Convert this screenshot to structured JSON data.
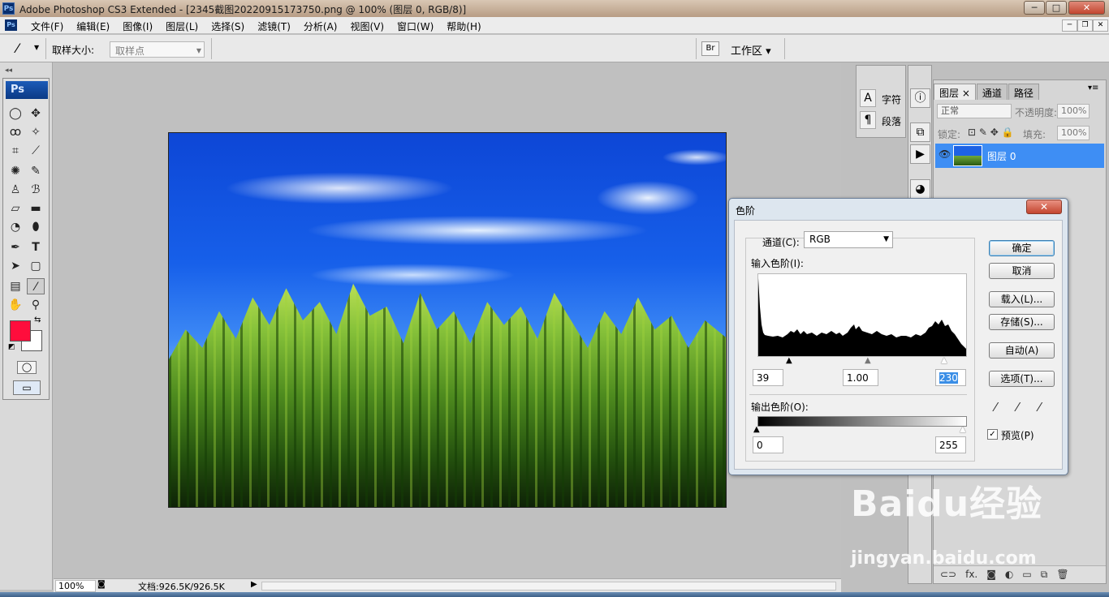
{
  "window": {
    "title": "Adobe Photoshop CS3 Extended - [2345截图20220915173750.png @ 100% (图层 0, RGB/8)]",
    "app_logo": "Ps"
  },
  "menu": [
    "文件(F)",
    "编辑(E)",
    "图像(I)",
    "图层(L)",
    "选择(S)",
    "滤镜(T)",
    "分析(A)",
    "视图(V)",
    "窗口(W)",
    "帮助(H)"
  ],
  "options": {
    "sample_size_label": "取样大小:",
    "sample_size_value": "取样点",
    "workspace_label": "工作区"
  },
  "toolbox": {
    "logo": "Ps",
    "foreground_color": "#ff0d3c",
    "background_color": "#ffffff"
  },
  "status": {
    "zoom": "100%",
    "doc_info": "文档:926.5K/926.5K"
  },
  "panels": {
    "character_label": "字符",
    "paragraph_label": "段落"
  },
  "layers": {
    "tabs": [
      "图层",
      "通道",
      "路径"
    ],
    "blend_mode": "正常",
    "opacity_label": "不透明度:",
    "opacity_value": "100%",
    "lock_label": "锁定:",
    "fill_label": "填充:",
    "fill_value": "100%",
    "layer_name": "图层 0"
  },
  "levels_dialog": {
    "title": "色阶",
    "channel_label": "通道(C):",
    "channel_value": "RGB",
    "input_levels_label": "输入色阶(I):",
    "input_black": "39",
    "input_gamma": "1.00",
    "input_white": "230",
    "output_levels_label": "输出色阶(O):",
    "output_black": "0",
    "output_white": "255",
    "buttons": {
      "ok": "确定",
      "cancel": "取消",
      "load": "载入(L)...",
      "save": "存储(S)...",
      "auto": "自动(A)",
      "options": "选项(T)..."
    },
    "preview_label": "预览(P)",
    "preview_checked": true
  },
  "watermark": {
    "brand": "Baidu经验",
    "url": "jingyan.baidu.com"
  }
}
